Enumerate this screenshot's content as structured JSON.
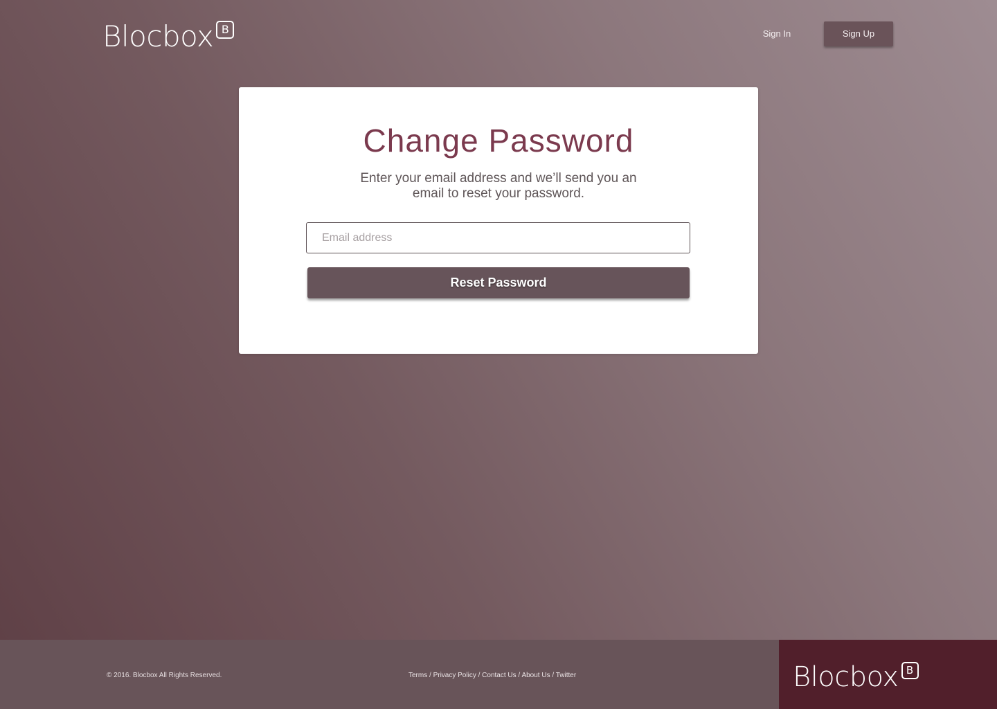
{
  "header": {
    "logo_text": "Blocbox",
    "logo_badge": "B",
    "signin_label": "Sign In",
    "signup_label": "Sign Up"
  },
  "card": {
    "title": "Change Password",
    "subtitle": "Enter your email address and we’ll send you an email to reset your password.",
    "email_placeholder": "Email address",
    "email_value": "",
    "reset_label": "Reset Password"
  },
  "footer": {
    "copyright": "© 2016. Blocbox All Rights Reserved.",
    "links": [
      "Terms",
      "Privacy Policy",
      "Contact Us",
      "About Us",
      "Twitter"
    ],
    "separator": " / ",
    "logo_text": "Blocbox",
    "logo_badge": "B"
  },
  "colors": {
    "accent_title": "#7b3a4e",
    "button": "#67545a",
    "footer_bg": "#685459",
    "footer_brand_bg": "#511f2b"
  }
}
